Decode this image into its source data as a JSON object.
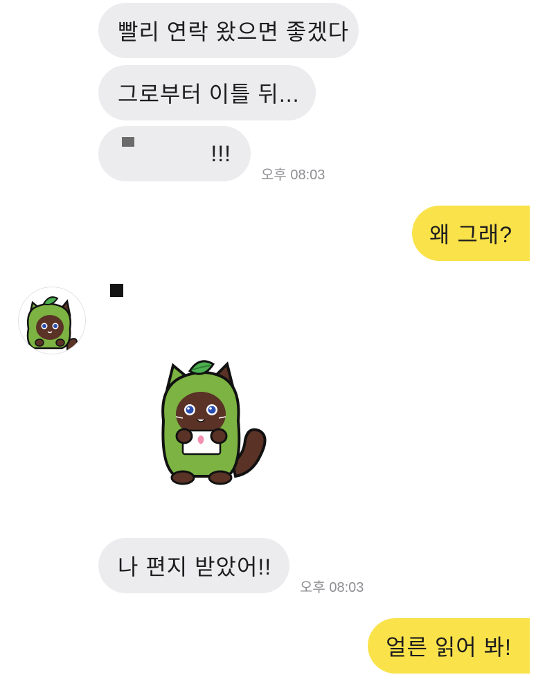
{
  "messages_in_top": [
    {
      "text": "빨리 연락 왔으면 좋겠다"
    },
    {
      "text": "그로부터 이틀 뒤..."
    },
    {
      "text": "!!!"
    }
  ],
  "timestamp_1": "오후 08:03",
  "reply_1": "왜 그래?",
  "sender": {
    "avatar_icon": "green-hood-cat-avatar",
    "name_mark": "redacted-name-square"
  },
  "sticker": {
    "icon": "green-hood-cat-holding-letter-sticker"
  },
  "message_in_bottom": "나 편지 받았어!!",
  "timestamp_2": "오후 08:03",
  "reply_2": "얼른 읽어 봐!",
  "colors": {
    "incoming_bubble": "#ececef",
    "outgoing_bubble": "#fae24a",
    "timestamp": "#8e8e93",
    "cat_green": "#7cb342",
    "cat_brown": "#5a3226"
  }
}
